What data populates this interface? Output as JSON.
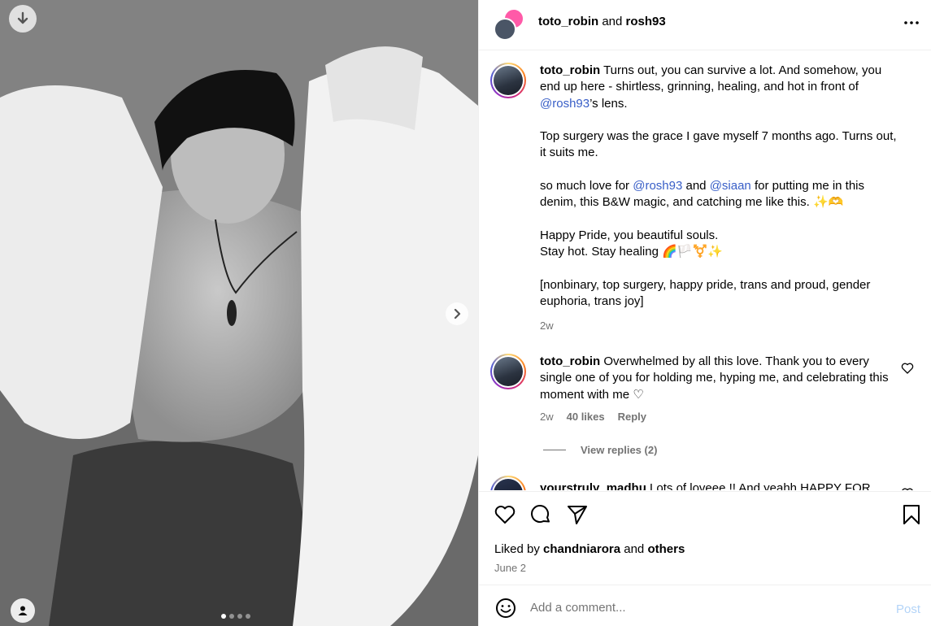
{
  "header": {
    "author": "toto_robin",
    "joiner": "and",
    "collaborator": "rosh93"
  },
  "post": {
    "caption": {
      "author": "toto_robin",
      "p1_text": "Turns out, you can survive a lot. And somehow, you end up here - shirtless, grinning, healing, and hot in front of ",
      "p1_mention": "@rosh93",
      "p1_tail": "’s lens.",
      "p2": "Top surgery was the grace I gave myself 7 months ago. Turns out, it suits me.",
      "p3_a": "so much love for ",
      "p3_mention1": "@rosh93",
      "p3_b": " and ",
      "p3_mention2": "@siaan",
      "p3_c": " for putting me in this denim, this B&W magic, and catching me like this. ✨🫶",
      "p4_l1": "Happy Pride, you beautiful souls.",
      "p4_l2": "Stay hot. Stay healing 🌈🏳️⚧️✨",
      "p5": "[nonbinary, top surgery, happy pride, trans and proud, gender euphoria, trans joy]",
      "time": "2w"
    },
    "comments": [
      {
        "author": "toto_robin",
        "text": "Overwhelmed by all this love. Thank you to every single one of you for holding me, hyping me, and celebrating this moment with me ♡",
        "time": "2w",
        "likes": "40 likes",
        "reply": "Reply",
        "view_replies": "View replies (2)"
      },
      {
        "author": "yourstruly_madhu",
        "text": "Lots of loveee !! And yeahh HAPPY FOR"
      }
    ],
    "liked_by_prefix": "Liked by",
    "liked_by_user": "chandniarora",
    "liked_by_and": "and",
    "liked_by_others": "others",
    "date": "June 2"
  },
  "add_comment": {
    "placeholder": "Add a comment...",
    "post_label": "Post"
  },
  "carousel": {
    "slide_count": 4,
    "active_index": 0
  }
}
